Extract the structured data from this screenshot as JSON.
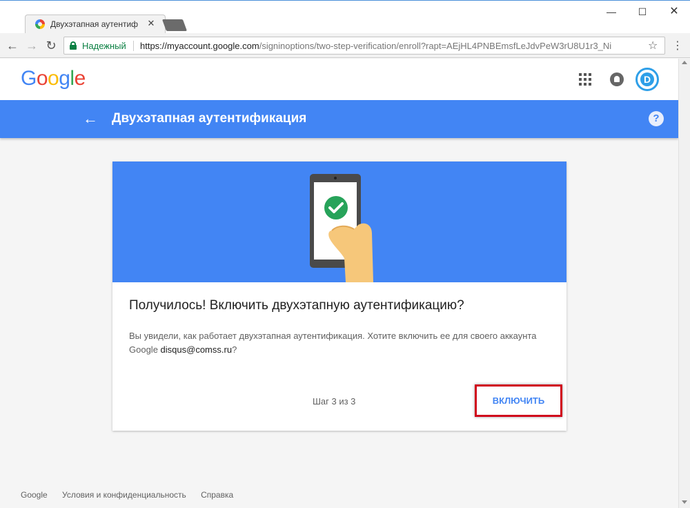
{
  "browser": {
    "tab_title": "Двухэтапная аутентиф",
    "tab_close": "✕",
    "secure_label": "Надежный",
    "url_main": "https://myaccount.google.com",
    "url_rest": "/signinoptions/two-step-verification/enroll?rapt=AEjHL4PNBEmsfLeJdvPeW3rU8U1r3_Ni",
    "win_min": "—",
    "win_max": "☐",
    "win_close": "✕",
    "back": "←",
    "forward": "→",
    "reload": "↻",
    "star": "☆",
    "menu": "⋮"
  },
  "header": {
    "logo_letters": [
      "G",
      "o",
      "o",
      "g",
      "l",
      "e"
    ],
    "logo_colors": [
      "#4285f4",
      "#ea4335",
      "#fbbc05",
      "#4285f4",
      "#34a853",
      "#ea4335"
    ],
    "avatar_letter": "D"
  },
  "bar": {
    "back_arrow": "←",
    "title": "Двухэтапная аутентификация",
    "help": "?"
  },
  "card": {
    "title": "Получилось! Включить двухэтапную аутентификацию?",
    "body_text": "Вы увидели, как работает двухэтапная аутентификация. Хотите включить ее для своего аккаунта Google ",
    "email": "disqus@comss.ru",
    "body_end": "?",
    "step": "Шаг 3 из 3",
    "enable_button": "ВКЛЮЧИТЬ"
  },
  "footer": {
    "links": [
      "Google",
      "Условия и конфиденциальность",
      "Справка"
    ]
  },
  "colors": {
    "brand_blue": "#4285f4",
    "secure_green": "#0b8043",
    "highlight_red": "#d0021b",
    "check_green": "#27a35a"
  }
}
